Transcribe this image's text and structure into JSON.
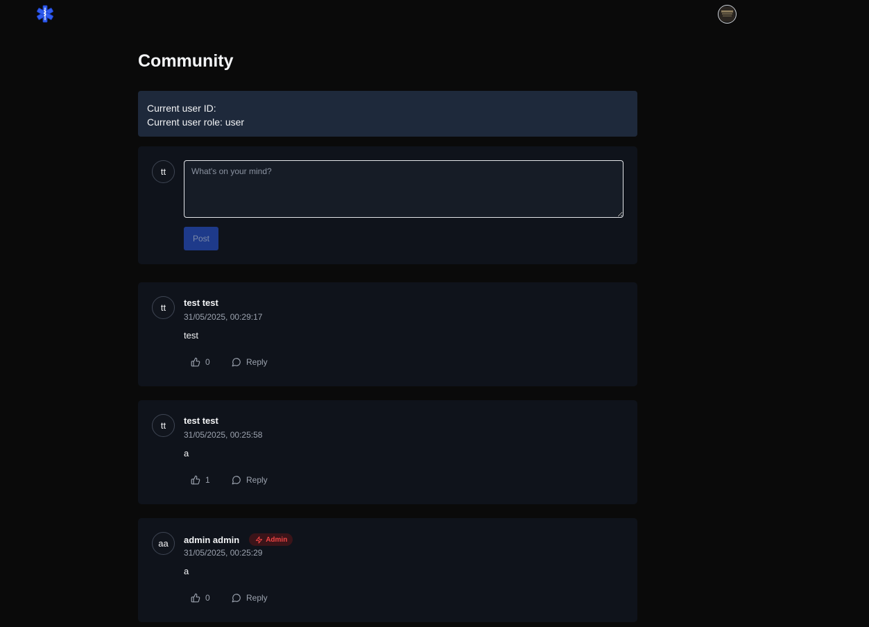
{
  "header": {
    "logo_icon": "star-of-life-icon",
    "user_avatar_icon": "user-avatar-image"
  },
  "page_title": "Community",
  "info": {
    "user_id_label": "Current user ID:",
    "user_role_label": "Current user role: user"
  },
  "composer": {
    "avatar_initials": "tt",
    "placeholder": "What's on your mind?",
    "value": "",
    "post_label": "Post"
  },
  "posts": [
    {
      "avatar_initials": "tt",
      "author": "test test",
      "badge": "",
      "timestamp": "31/05/2025, 00:29:17",
      "body": "test",
      "likes": "0",
      "reply_label": "Reply"
    },
    {
      "avatar_initials": "tt",
      "author": "test test",
      "badge": "",
      "timestamp": "31/05/2025, 00:25:58",
      "body": "a",
      "likes": "1",
      "reply_label": "Reply"
    },
    {
      "avatar_initials": "aa",
      "author": "admin admin",
      "badge": "Admin",
      "timestamp": "31/05/2025, 00:25:29",
      "body": "a",
      "likes": "0",
      "reply_label": "Reply"
    }
  ],
  "colors": {
    "background": "#0a0a0a",
    "card": "#0f131b",
    "info_box": "#1e293b",
    "primary_button": "#1e3a8a",
    "admin_badge_text": "#ef4444",
    "logo": "#2f5cf0"
  }
}
